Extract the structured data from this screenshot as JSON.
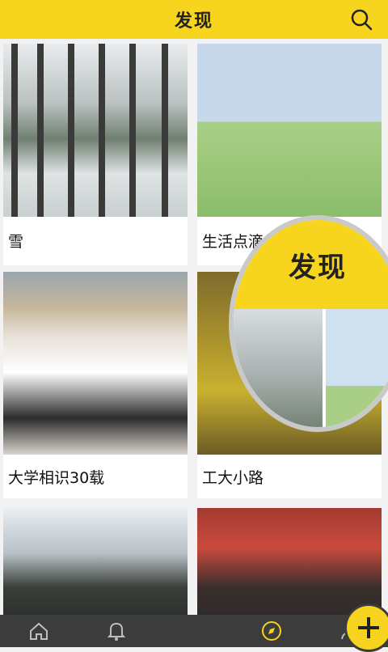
{
  "header": {
    "title": "发现"
  },
  "cards": [
    {
      "caption": "雪"
    },
    {
      "caption": "生活点滴"
    },
    {
      "caption": "大学相识30载"
    },
    {
      "caption": "工大小路"
    },
    {
      "caption": ""
    },
    {
      "caption": ""
    }
  ],
  "overlay": {
    "label": "发现"
  },
  "colors": {
    "accent": "#f7d41e",
    "nav_bg": "#3c3c3c"
  },
  "icons": [
    "search-icon",
    "home-icon",
    "bell-icon",
    "add-icon",
    "compass-icon",
    "user-icon"
  ]
}
